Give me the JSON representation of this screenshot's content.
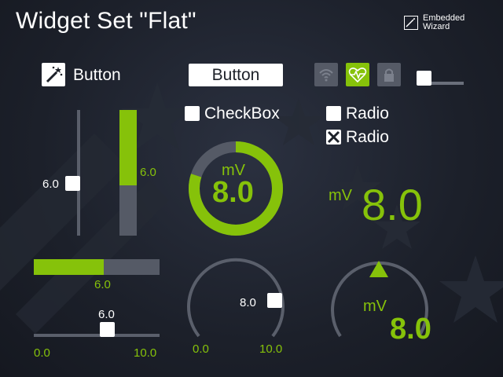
{
  "header": {
    "title": "Widget Set \"Flat\"",
    "logo_line1": "Embedded",
    "logo_line2": "Wizard"
  },
  "buttons": {
    "icon_button_label": "Button",
    "push_button_label": "Button"
  },
  "toggles": [
    {
      "icon": "wifi-icon",
      "state": "off"
    },
    {
      "icon": "heartbeat-icon",
      "state": "on"
    },
    {
      "icon": "lock-icon",
      "state": "off"
    }
  ],
  "top_slider": {
    "level": 0.0
  },
  "checkbox": {
    "label": "CheckBox",
    "checked": false
  },
  "radios": [
    {
      "label": "Radio",
      "selected": false
    },
    {
      "label": "Radio",
      "selected": true
    }
  ],
  "vertical_slider": {
    "value_label": "6.0",
    "value": 6.0,
    "min": 0.0,
    "max": 10.0
  },
  "vertical_bar": {
    "value_label": "6.0",
    "value": 6.0,
    "max": 10.0
  },
  "horizontal_bar": {
    "value_label": "6.0",
    "value": 6.0,
    "max": 10.0
  },
  "horizontal_slider": {
    "value_label": "6.0",
    "value": 6.0,
    "min_label": "0.0",
    "max_label": "10.0",
    "min": 0.0,
    "max": 10.0
  },
  "ring_gauge": {
    "unit": "mV",
    "value_label": "8.0",
    "value": 8.0,
    "max": 10.0
  },
  "digital_display": {
    "unit": "mV",
    "value_label": "8.0"
  },
  "rotary_knob": {
    "value_label": "8.0",
    "value": 8.0,
    "min_label": "0.0",
    "max_label": "10.0"
  },
  "arc_gauge": {
    "unit": "mV",
    "value_label": "8.0",
    "value": 8.0
  },
  "colors": {
    "accent": "#86c20a",
    "track": "#555a66",
    "background": "#1c202a",
    "thumb": "#ffffff"
  }
}
